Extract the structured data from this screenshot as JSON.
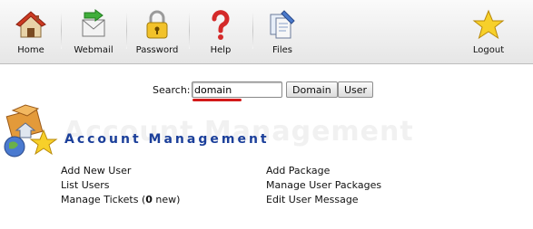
{
  "toolbar": {
    "items": [
      {
        "label": "Home",
        "icon": "home-icon"
      },
      {
        "label": "Webmail",
        "icon": "webmail-icon"
      },
      {
        "label": "Password",
        "icon": "lock-icon"
      },
      {
        "label": "Help",
        "icon": "question-icon"
      },
      {
        "label": "Files",
        "icon": "files-icon"
      },
      {
        "label": "Logout",
        "icon": "star-icon"
      }
    ]
  },
  "search": {
    "label": "Search:",
    "value": "domain",
    "buttons": {
      "domain": "Domain",
      "user": "User"
    }
  },
  "section": {
    "title": "Account Management",
    "watermark": "Account Management",
    "icon": "account-management-icon"
  },
  "links": {
    "left": [
      "Add New User",
      "List Users"
    ],
    "tickets_prefix": "Manage Tickets (",
    "tickets_count": "0",
    "tickets_suffix": " new)",
    "right": [
      "Add Package",
      "Manage User Packages",
      "Edit User Message"
    ]
  },
  "colors": {
    "title": "#1b3f9a",
    "underline": "#d31a1a"
  }
}
